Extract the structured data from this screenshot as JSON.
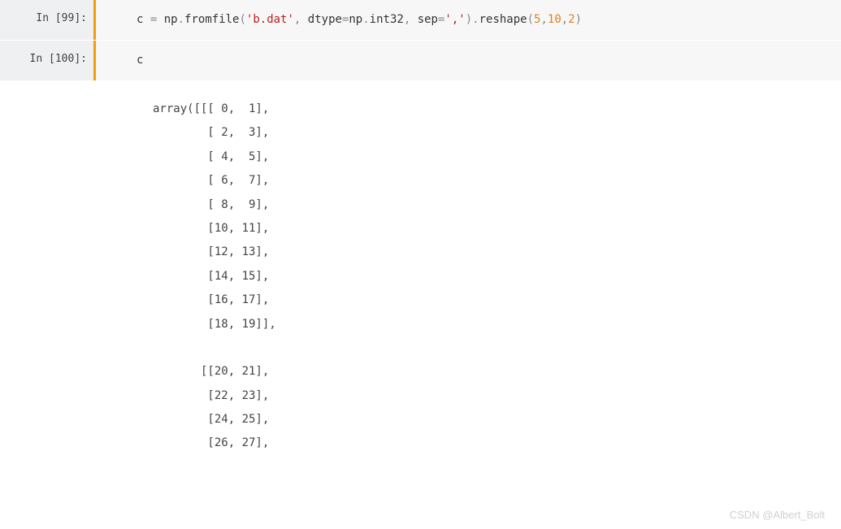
{
  "cells": [
    {
      "prompt": "In [99]:",
      "code_parts": {
        "p1": "c ",
        "op1": "=",
        "p2": " np",
        "dot1": ".",
        "p3": "fromfile",
        "paren1": "(",
        "str1": "'b.dat'",
        "comma1": ", ",
        "p4": "dtype",
        "op2": "=",
        "p5": "np",
        "dot2": ".",
        "p6": "int32",
        "comma2": ", ",
        "p7": "sep",
        "op3": "=",
        "str2": "','",
        "paren2": ")",
        "dot3": ".",
        "p8": "reshape",
        "paren3": "(",
        "num1": "5",
        "comma3": ",",
        "num2": "10",
        "comma4": ",",
        "num3": "2",
        "paren4": ")"
      }
    },
    {
      "prompt": "In [100]:",
      "code_parts": {
        "p1": "c"
      }
    }
  ],
  "output": "array([[[ 0,  1],\n        [ 2,  3],\n        [ 4,  5],\n        [ 6,  7],\n        [ 8,  9],\n        [10, 11],\n        [12, 13],\n        [14, 15],\n        [16, 17],\n        [18, 19]],\n\n       [[20, 21],\n        [22, 23],\n        [24, 25],\n        [26, 27],",
  "watermark": "CSDN @Albert_Bolt"
}
